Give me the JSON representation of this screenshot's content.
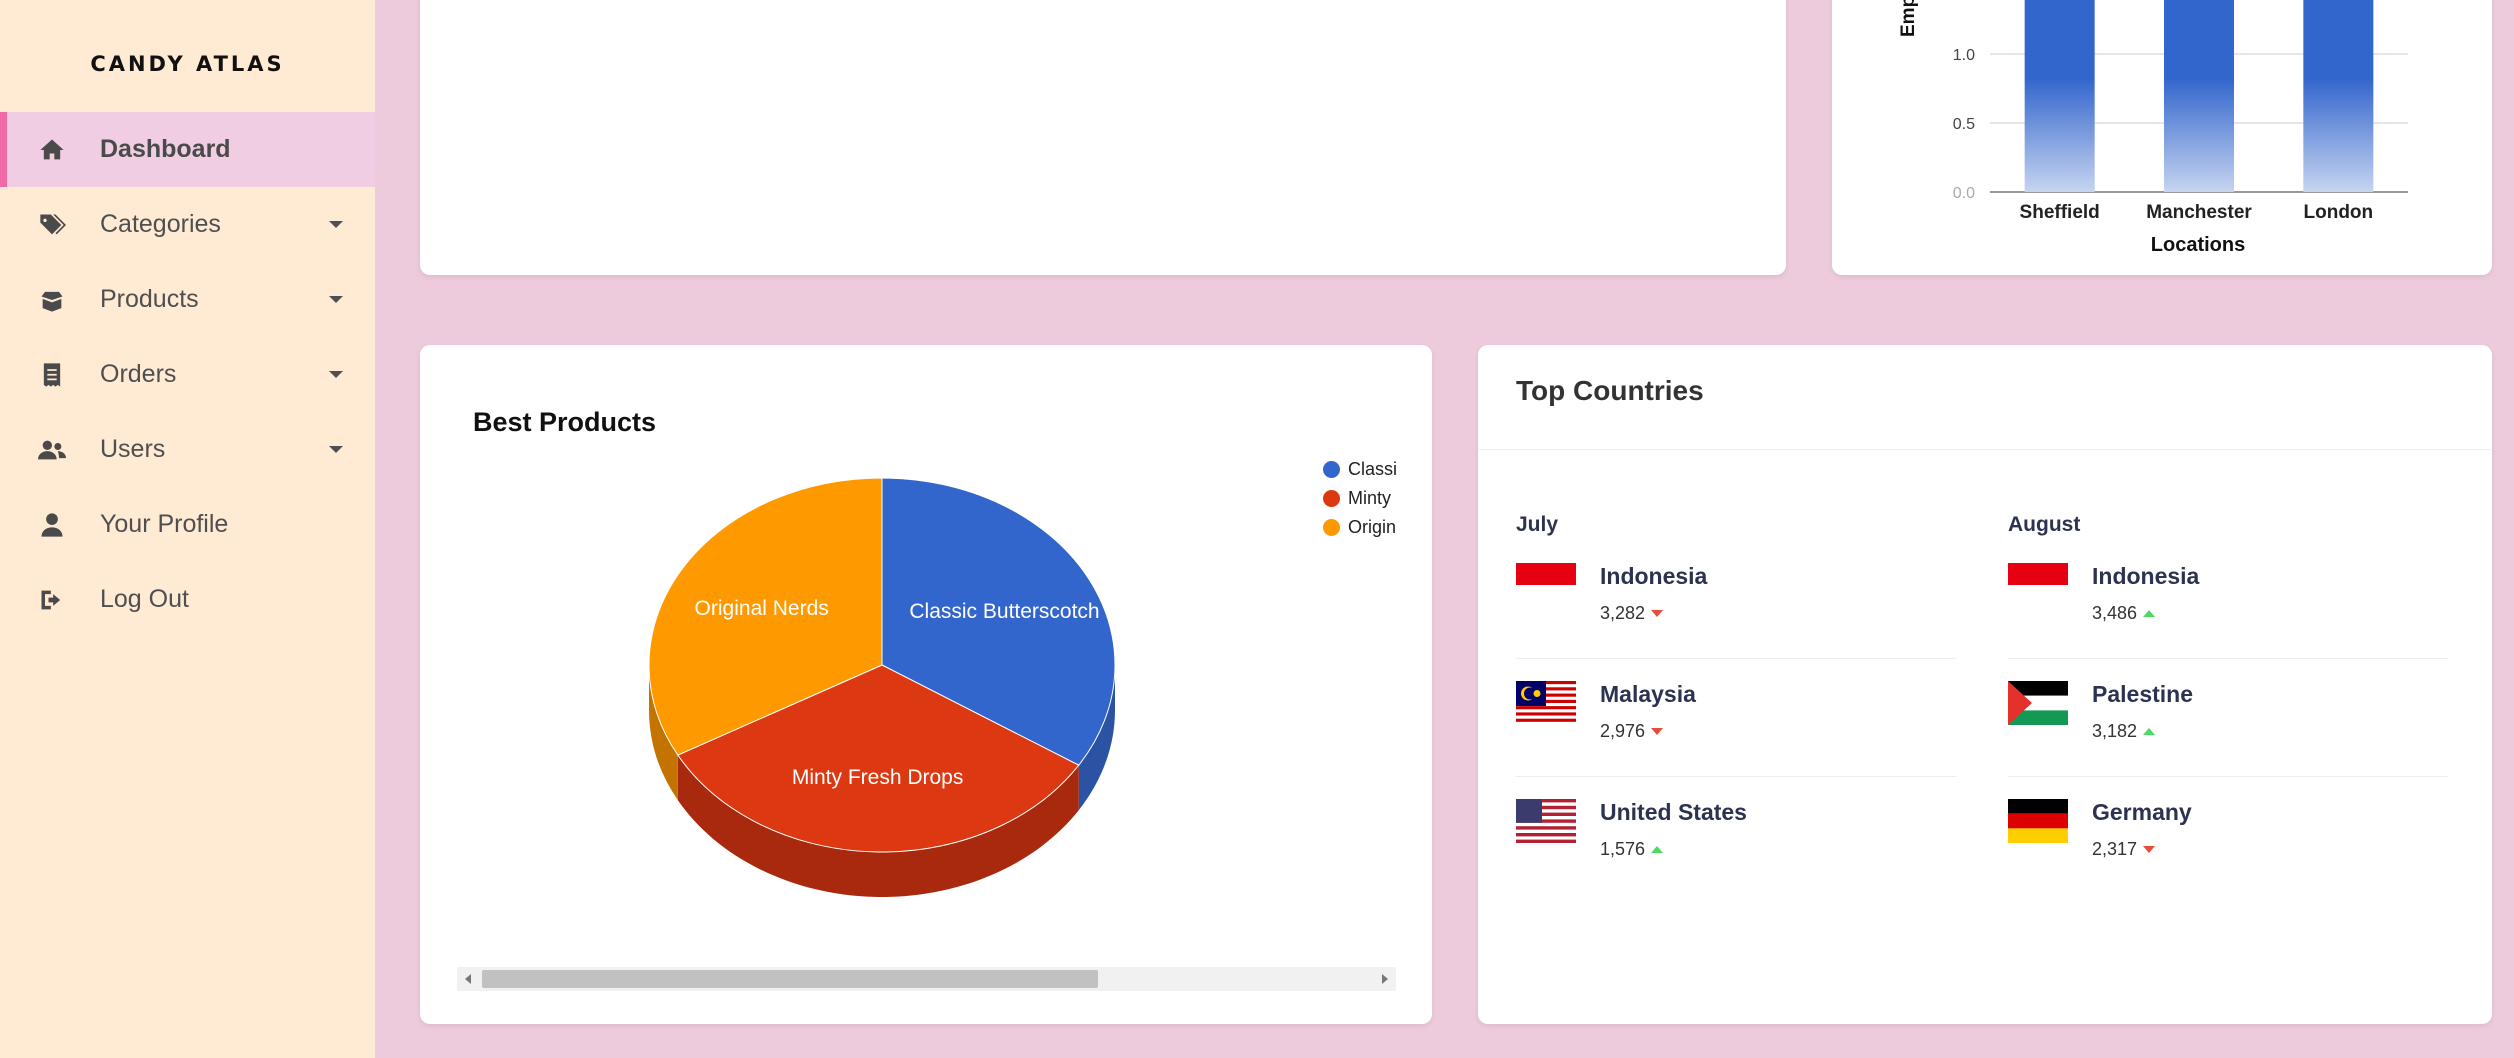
{
  "brand": "CANDY ATLAS",
  "sidebar": {
    "items": [
      {
        "label": "Dashboard",
        "icon": "home-icon",
        "active": true
      },
      {
        "label": "Categories",
        "icon": "tags-icon",
        "dropdown": true
      },
      {
        "label": "Products",
        "icon": "box-open-icon",
        "dropdown": true
      },
      {
        "label": "Orders",
        "icon": "receipt-icon",
        "dropdown": true
      },
      {
        "label": "Users",
        "icon": "users-icon",
        "dropdown": true
      },
      {
        "label": "Your Profile",
        "icon": "user-icon"
      },
      {
        "label": "Log Out",
        "icon": "sign-out-icon"
      }
    ]
  },
  "colors": {
    "background": "#edcbdc",
    "sidebar": "#ffebd4",
    "active_item": "#f0cde2",
    "active_accent": "#f06aa8",
    "bar": "#3366cc",
    "pie_blue": "#3366cc",
    "pie_red": "#dc3912",
    "pie_orange": "#ff9900",
    "trend_down": "#e84a3c",
    "trend_up": "#4cd964"
  },
  "chart_data": [
    {
      "type": "bar",
      "categories": [
        "Sheffield",
        "Manchester",
        "London"
      ],
      "ytick_labels": [
        "0.0",
        "0.5",
        "1.0"
      ],
      "ylabel": "Emp",
      "xlabel": "Locations",
      "values_visible_min": [
        1.0,
        1.0,
        1.0
      ],
      "note_clipped": true
    },
    {
      "type": "pie",
      "title": "Best Products",
      "labels": [
        "Classic Butterscotch",
        "Minty Fresh Drops",
        "Original Nerds"
      ],
      "legend_labels": [
        "Classi",
        "Minty",
        "Origin"
      ],
      "values": [
        34,
        33,
        33
      ],
      "legend": "top-right"
    }
  ],
  "countries": {
    "title": "Top Countries",
    "columns": [
      {
        "month": "July",
        "rows": [
          {
            "name": "Indonesia",
            "count": "3,282",
            "trend": "down",
            "flag": "indonesia-flag-icon"
          },
          {
            "name": "Malaysia",
            "count": "2,976",
            "trend": "down",
            "flag": "malaysia-flag-icon"
          },
          {
            "name": "United States",
            "count": "1,576",
            "trend": "up",
            "flag": "us-flag-icon"
          }
        ]
      },
      {
        "month": "August",
        "rows": [
          {
            "name": "Indonesia",
            "count": "3,486",
            "trend": "up",
            "flag": "indonesia-flag-icon"
          },
          {
            "name": "Palestine",
            "count": "3,182",
            "trend": "up",
            "flag": "palestine-flag-icon"
          },
          {
            "name": "Germany",
            "count": "2,317",
            "trend": "down",
            "flag": "germany-flag-icon"
          }
        ]
      }
    ]
  }
}
